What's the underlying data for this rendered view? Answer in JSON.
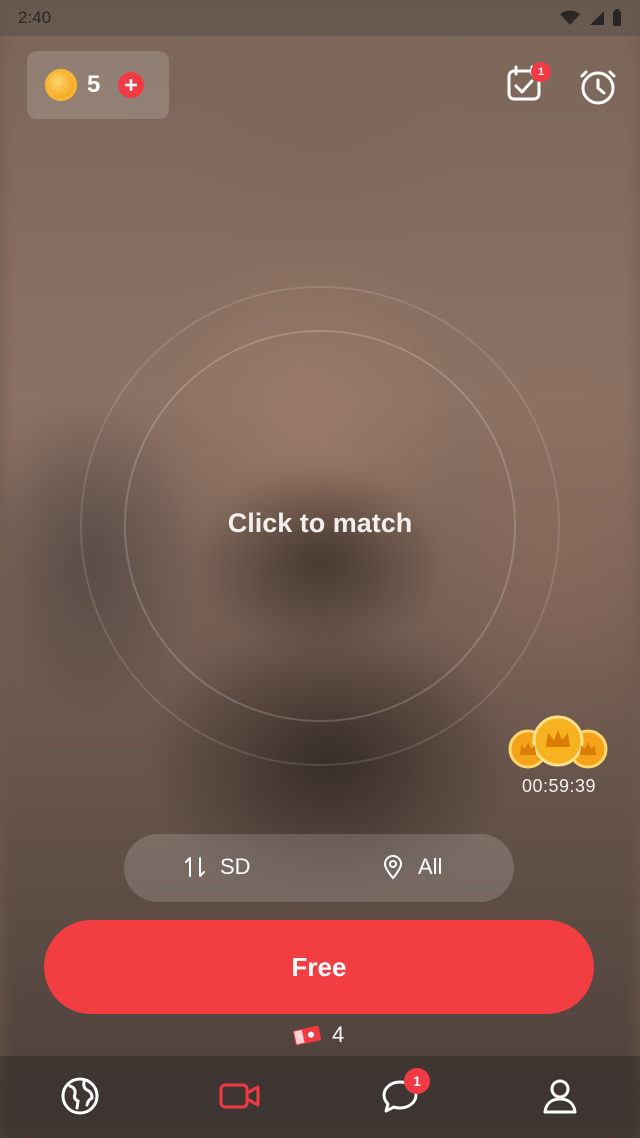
{
  "status_bar": {
    "time": "2:40"
  },
  "wallet": {
    "coin_count": "5"
  },
  "top_actions": {
    "checkin_badge": "1"
  },
  "match": {
    "prompt": "Click to match"
  },
  "reward": {
    "countdown": "00:59:39"
  },
  "filters": {
    "quality": "SD",
    "region": "All"
  },
  "cta": {
    "label": "Free"
  },
  "tickets": {
    "count": "4"
  },
  "nav": {
    "messages_badge": "1"
  },
  "colors": {
    "accent": "#F23D43",
    "coin": "#F3A21A"
  }
}
